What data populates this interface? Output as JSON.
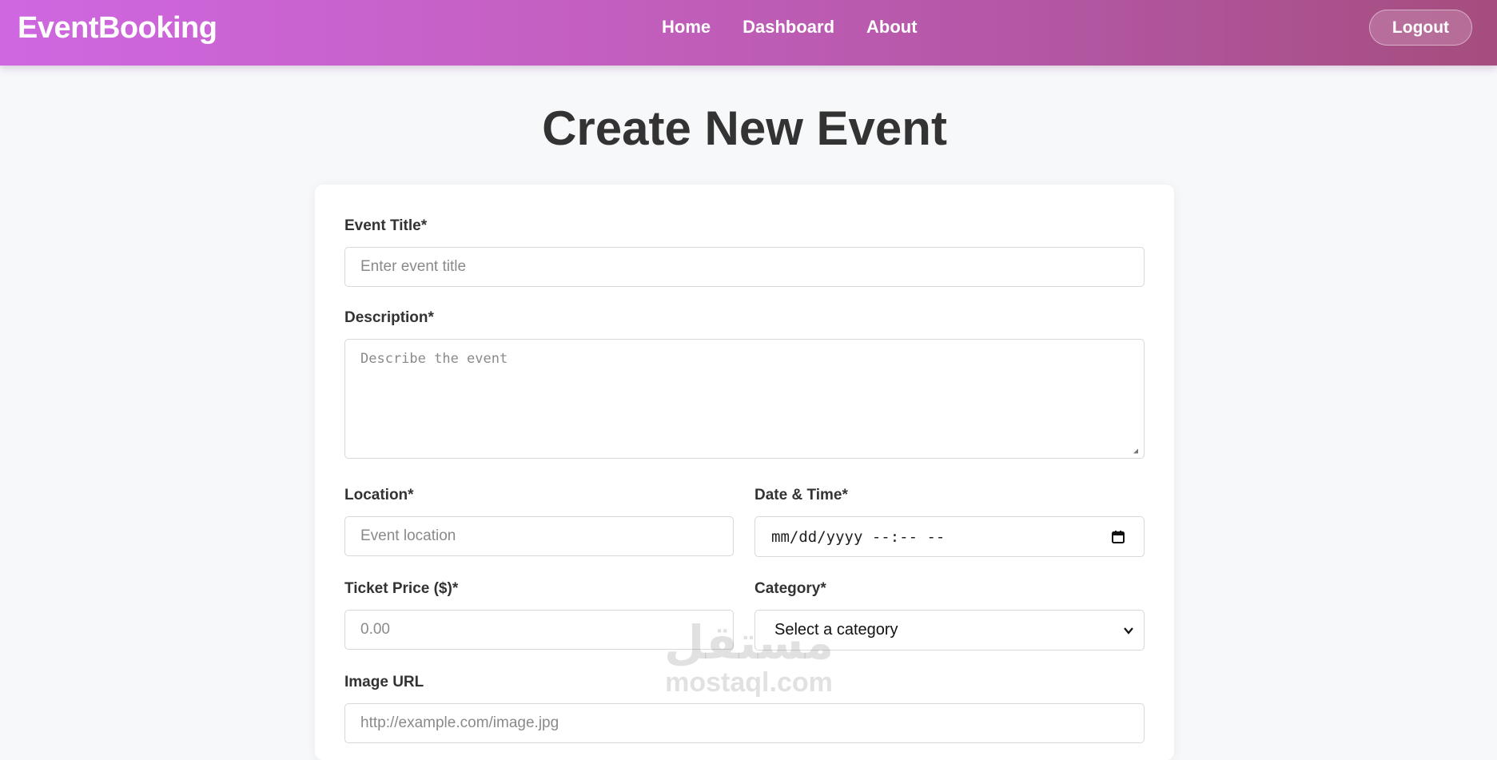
{
  "navbar": {
    "brand": "EventBooking",
    "links": [
      "Home",
      "Dashboard",
      "About"
    ],
    "logout_label": "Logout"
  },
  "page": {
    "title": "Create New Event"
  },
  "form": {
    "title": {
      "label": "Event Title*",
      "placeholder": "Enter event title"
    },
    "description": {
      "label": "Description*",
      "placeholder": "Describe the event"
    },
    "location": {
      "label": "Location*",
      "placeholder": "Event location"
    },
    "datetime": {
      "label": "Date & Time*",
      "value": "mm/dd/yyyy --:-- --"
    },
    "price": {
      "label": "Ticket Price ($)*",
      "placeholder": "0.00"
    },
    "category": {
      "label": "Category*",
      "selected": "Select a category"
    },
    "image": {
      "label": "Image URL",
      "placeholder": "http://example.com/image.jpg"
    }
  },
  "watermark": {
    "arabic": "مستقل",
    "latin": "mostaql.com"
  },
  "icons": {
    "calendar": "calendar-icon",
    "chevron": "chevron-down-icon"
  }
}
